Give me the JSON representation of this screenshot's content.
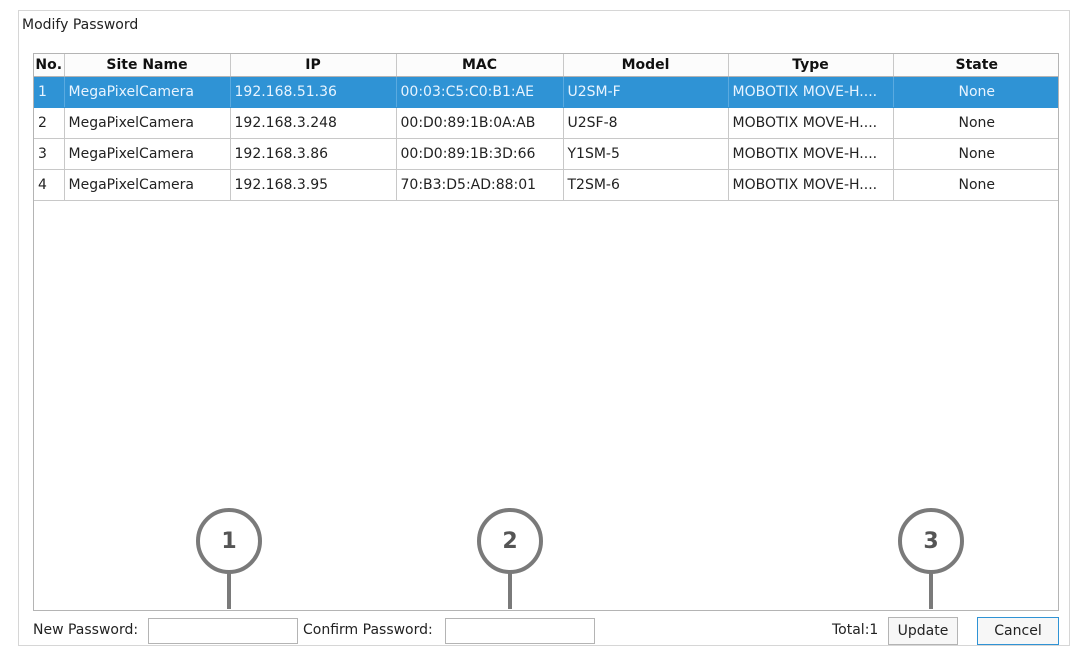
{
  "dialog": {
    "title": "Modify Password"
  },
  "table": {
    "columns": [
      "No.",
      "Site Name",
      "IP",
      "MAC",
      "Model",
      "Type",
      "State"
    ],
    "rows": [
      [
        "1",
        "MegaPixelCamera",
        "192.168.51.36",
        "00:03:C5:C0:B1:AE",
        "U2SM-F",
        "MOBOTIX MOVE-H....",
        "None"
      ],
      [
        "2",
        "MegaPixelCamera",
        "192.168.3.248",
        "00:D0:89:1B:0A:AB",
        "U2SF-8",
        "MOBOTIX MOVE-H....",
        "None"
      ],
      [
        "3",
        "MegaPixelCamera",
        "192.168.3.86",
        "00:D0:89:1B:3D:66",
        "Y1SM-5",
        "MOBOTIX MOVE-H....",
        "None"
      ],
      [
        "4",
        "MegaPixelCamera",
        "192.168.3.95",
        "70:B3:D5:AD:88:01",
        "T2SM-6",
        "MOBOTIX MOVE-H....",
        "None"
      ]
    ],
    "selected_row": 1
  },
  "footer": {
    "new_password_label": "New Password:",
    "new_password_value": "",
    "confirm_password_label": "Confirm Password:",
    "confirm_password_value": "",
    "total_label": "Total:1",
    "update_label": "Update",
    "cancel_label": "Cancel"
  },
  "callouts": [
    "1",
    "2",
    "3"
  ],
  "colors": {
    "selection": "#2f93d5",
    "callout": "#7a7a7a"
  }
}
